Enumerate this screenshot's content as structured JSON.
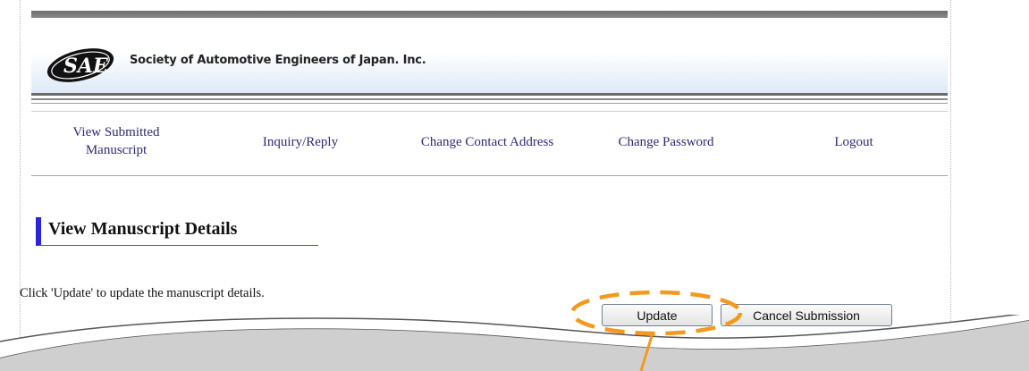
{
  "header": {
    "org_name": "Society of Automotive Engineers of Japan. Inc.",
    "logo_icon": "sae-logo-icon"
  },
  "nav": {
    "items": [
      {
        "line1": "View Submitted",
        "line2": "Manuscript"
      },
      {
        "label": "Inquiry/Reply"
      },
      {
        "label": "Change Contact Address"
      },
      {
        "label": "Change Password"
      },
      {
        "label": "Logout"
      }
    ]
  },
  "main": {
    "section_title": "View Manuscript Details",
    "instruction": "Click 'Update' to update the manuscript details.",
    "update_label": "Update",
    "cancel_label": "Cancel Submission"
  },
  "colors": {
    "nav_link": "#2c2a75",
    "title_accent": "#2a24e0",
    "callout": "#f39a1e"
  }
}
